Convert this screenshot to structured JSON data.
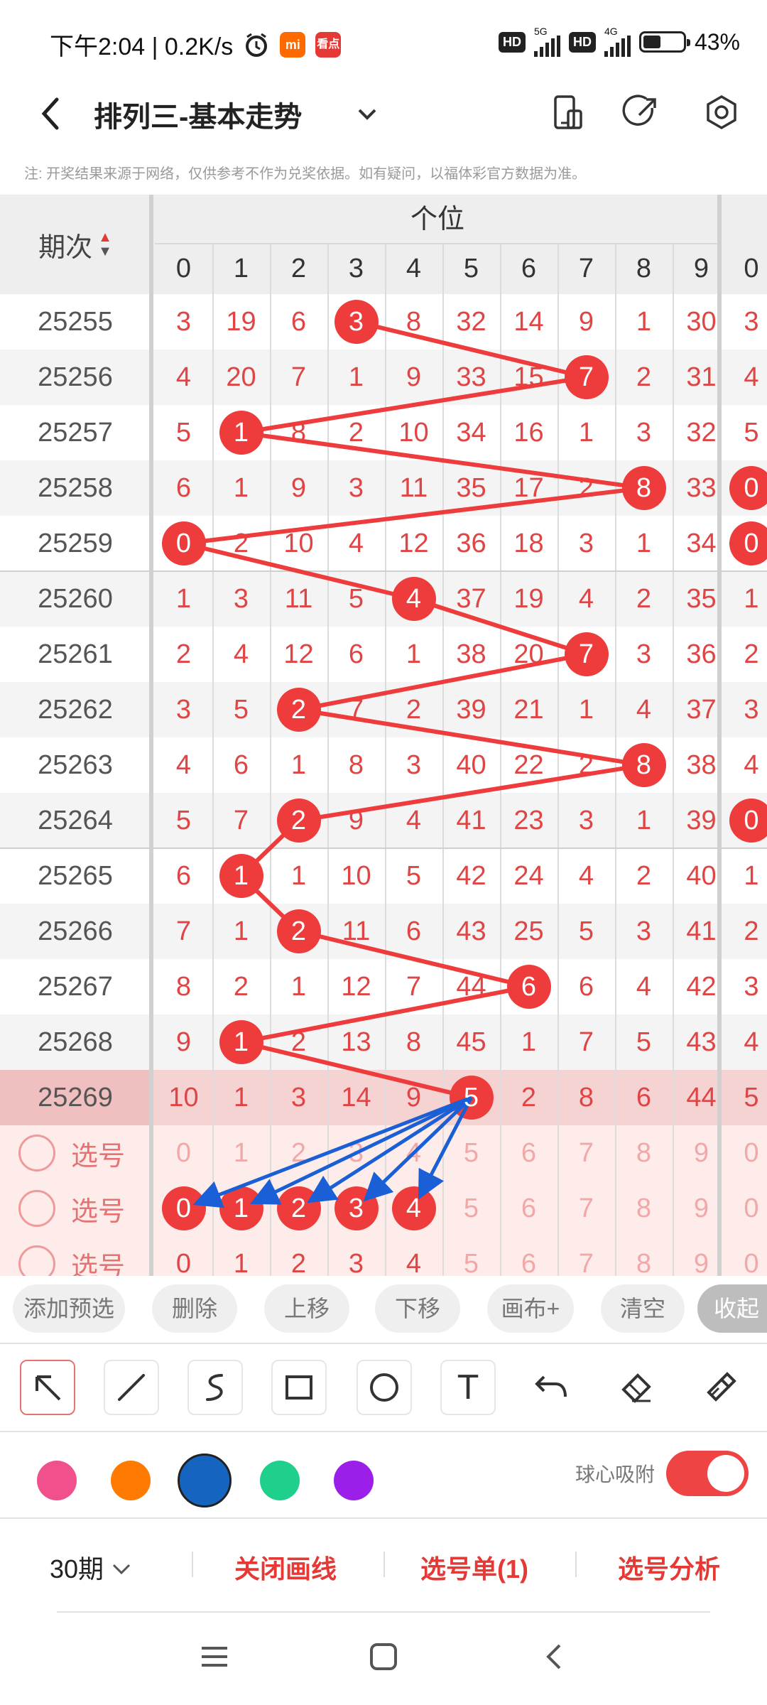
{
  "status": {
    "time_speed": "下午2:04 | 0.2K/s",
    "mi_label": "mi",
    "kandian_label": "看点",
    "hd1": "HD",
    "net1": "5G",
    "hd2": "HD",
    "net2": "4G",
    "battery": "43%"
  },
  "header": {
    "title": "排列三-基本走势",
    "back_icon": "back-arrow-icon",
    "dropdown_icon": "chevron-down-icon",
    "icons": [
      "phone-layout-icon",
      "share-icon",
      "settings-icon"
    ]
  },
  "notice": "注: 开奖结果来源于网络，仅供参考不作为兑奖依据。如有疑问，以福体彩官方数据为准。",
  "table": {
    "period_header": "期次",
    "group_header": "个位",
    "digit_headers": [
      "0",
      "1",
      "2",
      "3",
      "4",
      "5",
      "6",
      "7",
      "8",
      "9",
      "0"
    ],
    "rows": [
      {
        "period": "25255",
        "values": [
          "3",
          "19",
          "6",
          "3",
          "8",
          "32",
          "14",
          "9",
          "1",
          "30",
          "3"
        ],
        "hit": 3,
        "extra_hit": false
      },
      {
        "period": "25256",
        "values": [
          "4",
          "20",
          "7",
          "1",
          "9",
          "33",
          "15",
          "7",
          "2",
          "31",
          "4"
        ],
        "hit": 7,
        "extra_hit": false
      },
      {
        "period": "25257",
        "values": [
          "5",
          "1",
          "8",
          "2",
          "10",
          "34",
          "16",
          "1",
          "3",
          "32",
          "5"
        ],
        "hit": 1,
        "extra_hit": false
      },
      {
        "period": "25258",
        "values": [
          "6",
          "1",
          "9",
          "3",
          "11",
          "35",
          "17",
          "2",
          "8",
          "33",
          "0"
        ],
        "hit": 8,
        "extra_hit": true
      },
      {
        "period": "25259",
        "values": [
          "0",
          "2",
          "10",
          "4",
          "12",
          "36",
          "18",
          "3",
          "1",
          "34",
          "0"
        ],
        "hit": 0,
        "extra_hit": true
      },
      {
        "period": "25260",
        "values": [
          "1",
          "3",
          "11",
          "5",
          "4",
          "37",
          "19",
          "4",
          "2",
          "35",
          "1"
        ],
        "hit": 4,
        "extra_hit": false
      },
      {
        "period": "25261",
        "values": [
          "2",
          "4",
          "12",
          "6",
          "1",
          "38",
          "20",
          "7",
          "3",
          "36",
          "2"
        ],
        "hit": 7,
        "extra_hit": false
      },
      {
        "period": "25262",
        "values": [
          "3",
          "5",
          "2",
          "7",
          "2",
          "39",
          "21",
          "1",
          "4",
          "37",
          "3"
        ],
        "hit": 2,
        "extra_hit": false
      },
      {
        "period": "25263",
        "values": [
          "4",
          "6",
          "1",
          "8",
          "3",
          "40",
          "22",
          "2",
          "8",
          "38",
          "4"
        ],
        "hit": 8,
        "extra_hit": false
      },
      {
        "period": "25264",
        "values": [
          "5",
          "7",
          "2",
          "9",
          "4",
          "41",
          "23",
          "3",
          "1",
          "39",
          "0"
        ],
        "hit": 2,
        "extra_hit": true
      },
      {
        "period": "25265",
        "values": [
          "6",
          "1",
          "1",
          "10",
          "5",
          "42",
          "24",
          "4",
          "2",
          "40",
          "1"
        ],
        "hit": 1,
        "extra_hit": false
      },
      {
        "period": "25266",
        "values": [
          "7",
          "1",
          "2",
          "11",
          "6",
          "43",
          "25",
          "5",
          "3",
          "41",
          "2"
        ],
        "hit": 2,
        "extra_hit": false
      },
      {
        "period": "25267",
        "values": [
          "8",
          "2",
          "1",
          "12",
          "7",
          "44",
          "6",
          "6",
          "4",
          "42",
          "3"
        ],
        "hit": 6,
        "extra_hit": false
      },
      {
        "period": "25268",
        "values": [
          "9",
          "1",
          "2",
          "13",
          "8",
          "45",
          "1",
          "7",
          "5",
          "43",
          "4"
        ],
        "hit": 1,
        "extra_hit": false
      },
      {
        "period": "25269",
        "values": [
          "10",
          "1",
          "3",
          "14",
          "9",
          "5",
          "2",
          "8",
          "6",
          "44",
          "5"
        ],
        "hit": 5,
        "extra_hit": false
      }
    ],
    "pick_label": "选号",
    "pick_rows": [
      {
        "values": [
          "0",
          "1",
          "2",
          "3",
          "4",
          "5",
          "6",
          "7",
          "8",
          "9",
          "0"
        ],
        "selected": []
      },
      {
        "values": [
          "0",
          "1",
          "2",
          "3",
          "4",
          "5",
          "6",
          "7",
          "8",
          "9",
          "0"
        ],
        "selected": [
          0,
          1,
          2,
          3,
          4
        ]
      },
      {
        "values": [
          "0",
          "1",
          "2",
          "3",
          "4",
          "5",
          "6",
          "7",
          "8",
          "9",
          "0"
        ],
        "selected": []
      }
    ]
  },
  "actions": [
    "添加预选",
    "删除",
    "上移",
    "下移",
    "画布+",
    "清空",
    "收起"
  ],
  "tools": [
    "select-arrow-icon",
    "line-icon",
    "curve-icon",
    "rectangle-icon",
    "circle-icon",
    "text-icon",
    "undo-icon",
    "eraser-icon",
    "clear-brush-icon"
  ],
  "tool_text": "T",
  "colors": {
    "swatches": [
      "#f0508c",
      "#ff7a00",
      "#1565c0",
      "#1fd08c",
      "#9b1fe8"
    ],
    "selected_index": 2,
    "line_red": "#ee3b3b",
    "line_blue": "#1a5fd6"
  },
  "snap_label": "球心吸附",
  "snap_on": true,
  "bottom": {
    "periods": "30期",
    "close_draw": "关闭画线",
    "pick_list": "选号单(1)",
    "pick_analysis": "选号分析"
  },
  "nav_icons": [
    "menu-icon",
    "home-icon",
    "back-icon"
  ]
}
